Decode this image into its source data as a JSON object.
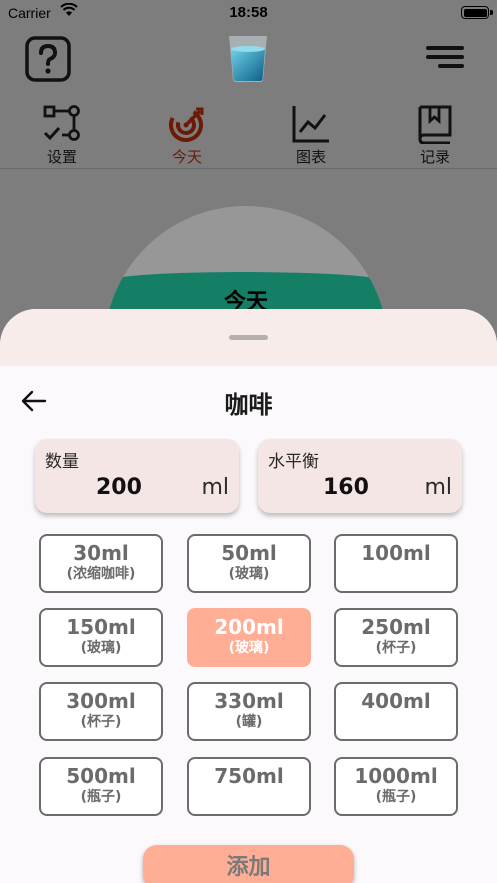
{
  "status_bar": {
    "carrier": "Carrier",
    "time": "18:58"
  },
  "tabs": [
    {
      "label": "设置",
      "icon": "settings-flow-icon"
    },
    {
      "label": "今天",
      "icon": "today-target-icon",
      "active": true
    },
    {
      "label": "图表",
      "icon": "chart-icon"
    },
    {
      "label": "记录",
      "icon": "record-book-icon"
    }
  ],
  "gauge": {
    "title": "今天"
  },
  "sheet": {
    "title": "咖啡",
    "amount": {
      "label": "数量",
      "value": "200",
      "unit": "ml"
    },
    "balance": {
      "label": "水平衡",
      "value": "160",
      "unit": "ml"
    },
    "options": [
      {
        "value": "30ml",
        "sub": "(浓缩咖啡)"
      },
      {
        "value": "50ml",
        "sub": "(玻璃)"
      },
      {
        "value": "100ml",
        "sub": ""
      },
      {
        "value": "150ml",
        "sub": "(玻璃)"
      },
      {
        "value": "200ml",
        "sub": "(玻璃)",
        "selected": true
      },
      {
        "value": "250ml",
        "sub": "(杯子)"
      },
      {
        "value": "300ml",
        "sub": "(杯子)"
      },
      {
        "value": "330ml",
        "sub": "(罐)"
      },
      {
        "value": "400ml",
        "sub": ""
      },
      {
        "value": "500ml",
        "sub": "(瓶子)"
      },
      {
        "value": "750ml",
        "sub": ""
      },
      {
        "value": "1000ml",
        "sub": "(瓶子)"
      }
    ],
    "add_label": "添加"
  },
  "colors": {
    "accent": "#ffad94",
    "active_tab": "#6b1b05",
    "water": "#147f65"
  }
}
